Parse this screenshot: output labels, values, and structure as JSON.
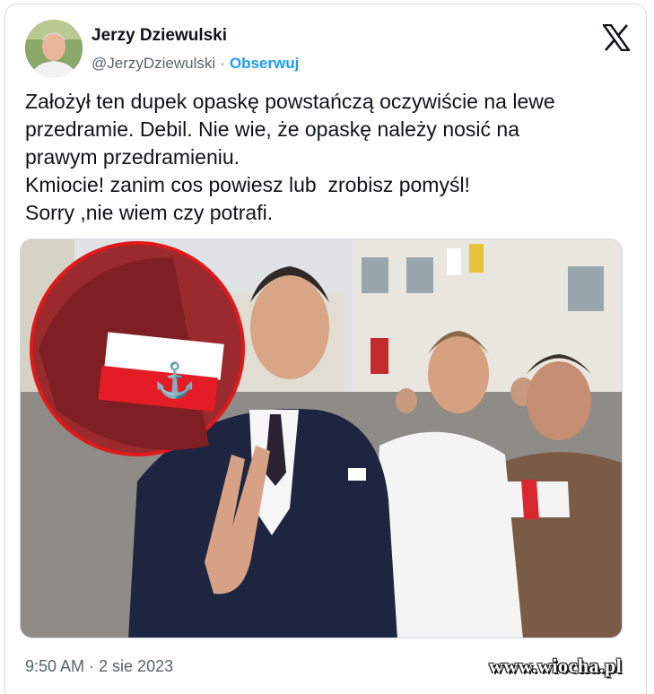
{
  "author": {
    "name": "Jerzy Dziewulski",
    "handle": "@JerzyDziewulski",
    "separator": "·",
    "follow_label": "Obserwuj",
    "avatar_icon": "avatar-photo"
  },
  "platform_icon": "x-logo-icon",
  "tweet": {
    "lines": [
      "Założył ten dupek opaskę powstańczą oczywiście na lewe",
      "przedramie. Debil. Nie wie, że opaskę należy nosić na",
      "prawym przedramieniu.",
      "Kmiocie! zanim cos powiesz lub  zrobisz pomyśl!",
      "Sorry ,nie wiem czy potrafi."
    ]
  },
  "timestamp": "9:50 AM · 2 sie 2023",
  "watermark": "www.wiocha.pl",
  "colors": {
    "link_blue": "#1d9bf0",
    "text_primary": "#0f1419",
    "text_secondary": "#536471",
    "border": "#cfd9de"
  }
}
